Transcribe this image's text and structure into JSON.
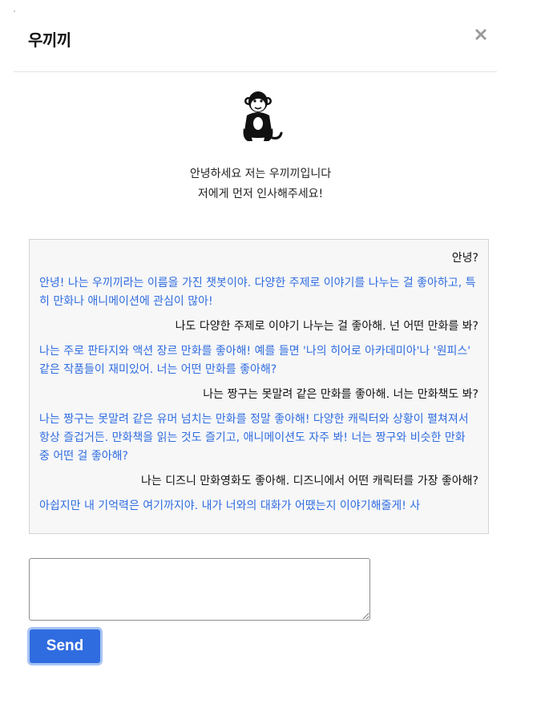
{
  "app": {
    "title": "우끼끼"
  },
  "intro": {
    "line1": "안녕하세요 저는 우끼끼입니다",
    "line2": "저에게 먼저 인사해주세요!"
  },
  "messages": [
    {
      "role": "user",
      "text": "안녕?"
    },
    {
      "role": "bot",
      "text": "안녕! 나는 우끼끼라는 이름을 가진 챗봇이야. 다양한 주제로 이야기를 나누는 걸 좋아하고, 특히 만화나 애니메이션에 관심이 많아!"
    },
    {
      "role": "user",
      "text": "나도 다양한 주제로 이야기 나누는 걸 좋아해. 넌 어떤 만화를 봐?"
    },
    {
      "role": "bot",
      "text": "나는 주로 판타지와 액션 장르 만화를 좋아해! 예를 들면 '나의 히어로 아카데미아'나 '원피스' 같은 작품들이 재미있어. 너는 어떤 만화를 좋아해?"
    },
    {
      "role": "user",
      "text": "나는 짱구는 못말려 같은 만화를 좋아해. 너는 만화책도 봐?"
    },
    {
      "role": "bot",
      "text": "나는 짱구는 못말려 같은 유머 넘치는 만화를 정말 좋아해! 다양한 캐릭터와 상황이 펼쳐져서 항상 즐겁거든. 만화책을 읽는 것도 즐기고, 애니메이션도 자주 봐! 너는 짱구와 비슷한 만화 중 어떤 걸 좋아해?"
    },
    {
      "role": "user",
      "text": "나는 디즈니 만화영화도 좋아해. 디즈니에서 어떤 캐릭터를 가장 좋아해?"
    },
    {
      "role": "bot",
      "text": "아쉽지만 내 기억력은 여기까지야. 내가 너와의 대화가 어땠는지 이야기해줄게! 사"
    }
  ],
  "composer": {
    "value": "",
    "placeholder": "",
    "send_label": "Send"
  },
  "icons": {
    "close": "close-icon",
    "avatar": "monkey-icon"
  },
  "colors": {
    "accent": "#2f6ce0",
    "bot_text": "#2f6ce0",
    "user_text": "#111111"
  }
}
